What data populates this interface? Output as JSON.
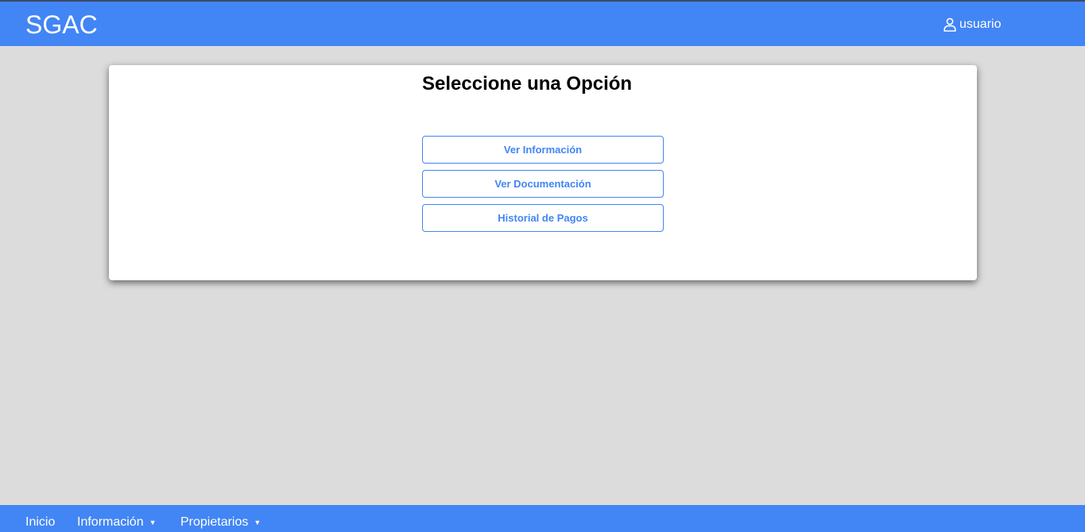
{
  "header": {
    "brand": "SGAC",
    "user_label": "usuario",
    "user_icon": "user-icon"
  },
  "main": {
    "title": "Seleccione una Opción",
    "options": [
      {
        "label": "Ver Información"
      },
      {
        "label": "Ver Documentación"
      },
      {
        "label": "Historial de Pagos"
      }
    ]
  },
  "footer_nav": {
    "items": [
      {
        "label": "Inicio"
      },
      {
        "label": "Información",
        "caret": "▼"
      },
      {
        "label": "Propietarios",
        "caret": "▼"
      }
    ]
  },
  "colors": {
    "accent": "#4285f4",
    "background": "#dcdcdc",
    "card": "#ffffff"
  }
}
